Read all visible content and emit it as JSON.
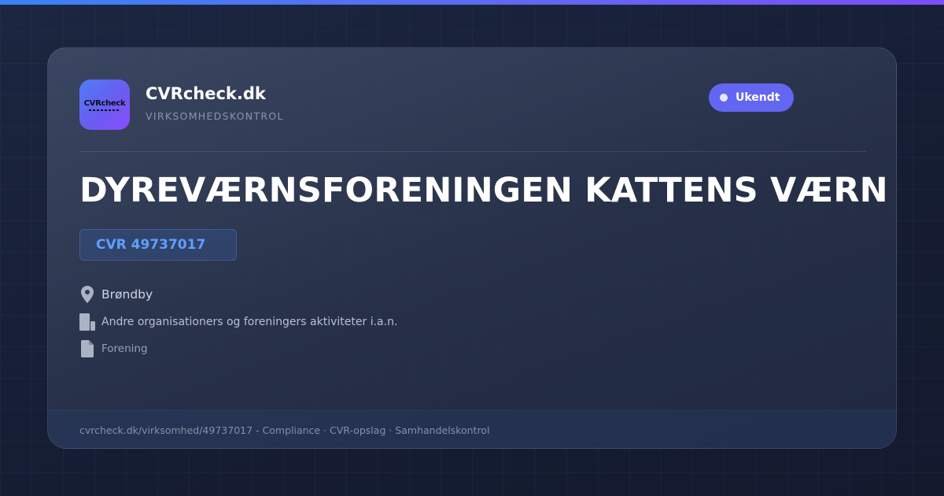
{
  "brand": {
    "logo_text": "CVRcheck",
    "name": "CVRcheck.dk",
    "tagline": "VIRKSOMHEDSKONTROL"
  },
  "status": {
    "label": "Ukendt",
    "color": "#6366f1"
  },
  "company": {
    "name": "DYREVÆRNSFORENINGEN KATTENS VÆRN",
    "cvr_label": "CVR 49737017",
    "location": "Brøndby",
    "industry": "Andre organisationers og foreningers aktiviteter i.a.n.",
    "type": "Forening"
  },
  "icons": {
    "location": "map-pin-icon",
    "industry": "building-icon",
    "type": "document-icon"
  },
  "footer": {
    "text": "cvrcheck.dk/virksomhed/49737017 - Compliance · CVR-opslag · Samhandelskontrol"
  },
  "colors": {
    "accent_blue": "#3b82f6",
    "accent_purple": "#7c4dff",
    "cvr_text": "#5ea0ff"
  }
}
